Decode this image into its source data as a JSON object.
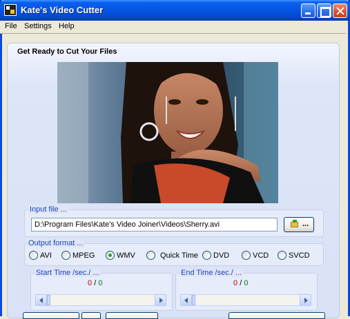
{
  "window": {
    "title": "Kate's Video Cutter"
  },
  "menu": {
    "items": [
      "File",
      "Settings",
      "Help"
    ]
  },
  "heading": "Get Ready to Cut Your Files",
  "input_file": {
    "label": "Input file ...",
    "value": "D:\\Program Files\\Kate's Video Joiner\\Videos\\Sherry.avi",
    "browse_label": "..."
  },
  "output_format": {
    "label": "Output format ...",
    "options": [
      "AVI",
      "MPEG",
      "WMV",
      "Quick Time",
      "DVD",
      "VCD",
      "SVCD"
    ],
    "selected": "WMV"
  },
  "start_time": {
    "label": "Start Time /sec./ ...",
    "current": "0",
    "sep": "/",
    "total": "0"
  },
  "end_time": {
    "label": "End Time /sec./ ...",
    "current": "0",
    "sep": "/",
    "total": "0"
  },
  "colors": {
    "title_bar": "#0554E3",
    "group_label": "#1C45B6",
    "radio_checked": "#21A121",
    "counter_current": "#C00000",
    "counter_total": "#008000"
  },
  "icons": [
    "app-icon",
    "minimize-icon",
    "maximize-icon",
    "close-icon",
    "folder-icon",
    "scroll-left-icon",
    "scroll-right-icon"
  ]
}
